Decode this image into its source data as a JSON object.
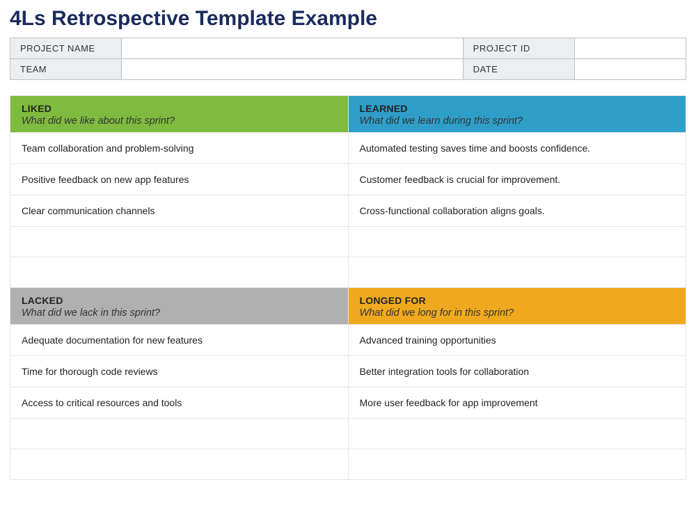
{
  "title": "4Ls Retrospective Template Example",
  "info": {
    "projectNameLabel": "PROJECT NAME",
    "projectNameValue": "",
    "projectIdLabel": "PROJECT ID",
    "projectIdValue": "",
    "teamLabel": "TEAM",
    "teamValue": "",
    "dateLabel": "DATE",
    "dateValue": ""
  },
  "quadrants": {
    "liked": {
      "title": "LIKED",
      "prompt": "What did we like about this sprint?",
      "items": [
        "Team collaboration and problem-solving",
        "Positive feedback on new app features",
        "Clear communication channels"
      ]
    },
    "learned": {
      "title": "LEARNED",
      "prompt": "What did we learn during this sprint?",
      "items": [
        "Automated testing saves time and boosts confidence.",
        "Customer feedback is crucial for improvement.",
        "Cross-functional collaboration aligns goals."
      ]
    },
    "lacked": {
      "title": "LACKED",
      "prompt": "What did we lack in this sprint?",
      "items": [
        "Adequate documentation for new features",
        "Time for thorough code reviews",
        "Access to critical resources and tools"
      ]
    },
    "longed": {
      "title": "LONGED FOR",
      "prompt": "What did we long for in this sprint?",
      "items": [
        "Advanced training opportunities",
        "Better integration tools for collaboration",
        "More user feedback for app improvement"
      ]
    }
  }
}
